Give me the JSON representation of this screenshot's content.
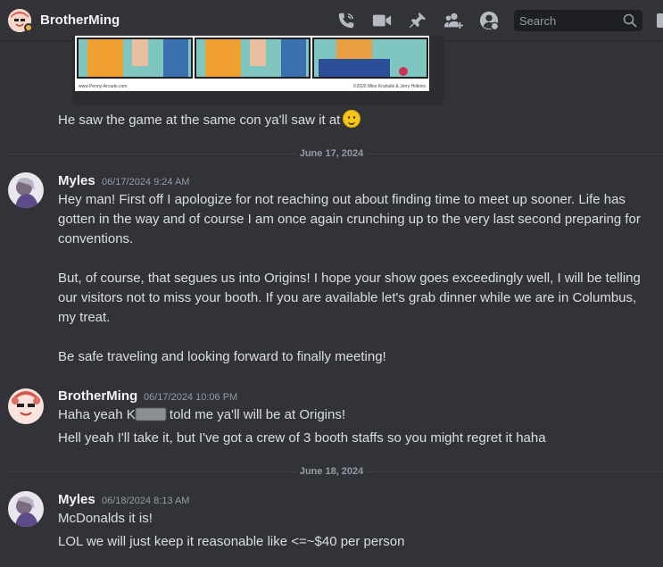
{
  "header": {
    "dm_name": "BrotherMing",
    "search_placeholder": "Search",
    "icons": [
      "phone-call-icon",
      "video-icon",
      "pin-icon",
      "add-friend-icon",
      "profile-icon",
      "search-icon",
      "inbox-icon"
    ]
  },
  "embed": {
    "caption_left": "www.Penny-Arcade.com",
    "caption_right": "©2020 Mike Krahulik & Jerry Holkins"
  },
  "messages": {
    "m0_line": "He saw the game at the same con ya'll saw it at",
    "divider1": "June 17, 2024",
    "m1_user": "Myles",
    "m1_time": "06/17/2024 9:24 AM",
    "m1_l1": "Hey man!  First off I apologize for not reaching out about finding time to meet up sooner.  Life has",
    "m1_l2": "gotten in the way and of course I am once again crunching up to the very last second preparing for",
    "m1_l3": "conventions.",
    "m1_l4": "But, of course, that segues us into Origins!  I hope your show goes exceedingly well, I will be telling",
    "m1_l5": "our visitors not to miss your booth.  If you are available let's grab dinner while we are in Columbus,",
    "m1_l6": "my treat.",
    "m1_l7": "Be safe traveling and looking forward to finally meeting!",
    "m2_user": "BrotherMing",
    "m2_time": "06/17/2024 10:06 PM",
    "m2_l1a": "Haha yeah K",
    "m2_l1b": " told me ya'll will be at Origins!",
    "m2_l2": "Hell yeah I'll take it, but I've got a crew of 3 booth staffs so you might regret it haha",
    "divider2": "June 18, 2024",
    "m3_user": "Myles",
    "m3_time": "06/18/2024 8:13 AM",
    "m3_l1": "McDonalds it is!",
    "m3_l2": "LOL we will just keep it reasonable like <=~$40 per person"
  },
  "colors": {
    "background": "#313338",
    "status_idle": "#f0b232",
    "text": "#dbdee1",
    "muted": "#949ba4"
  }
}
